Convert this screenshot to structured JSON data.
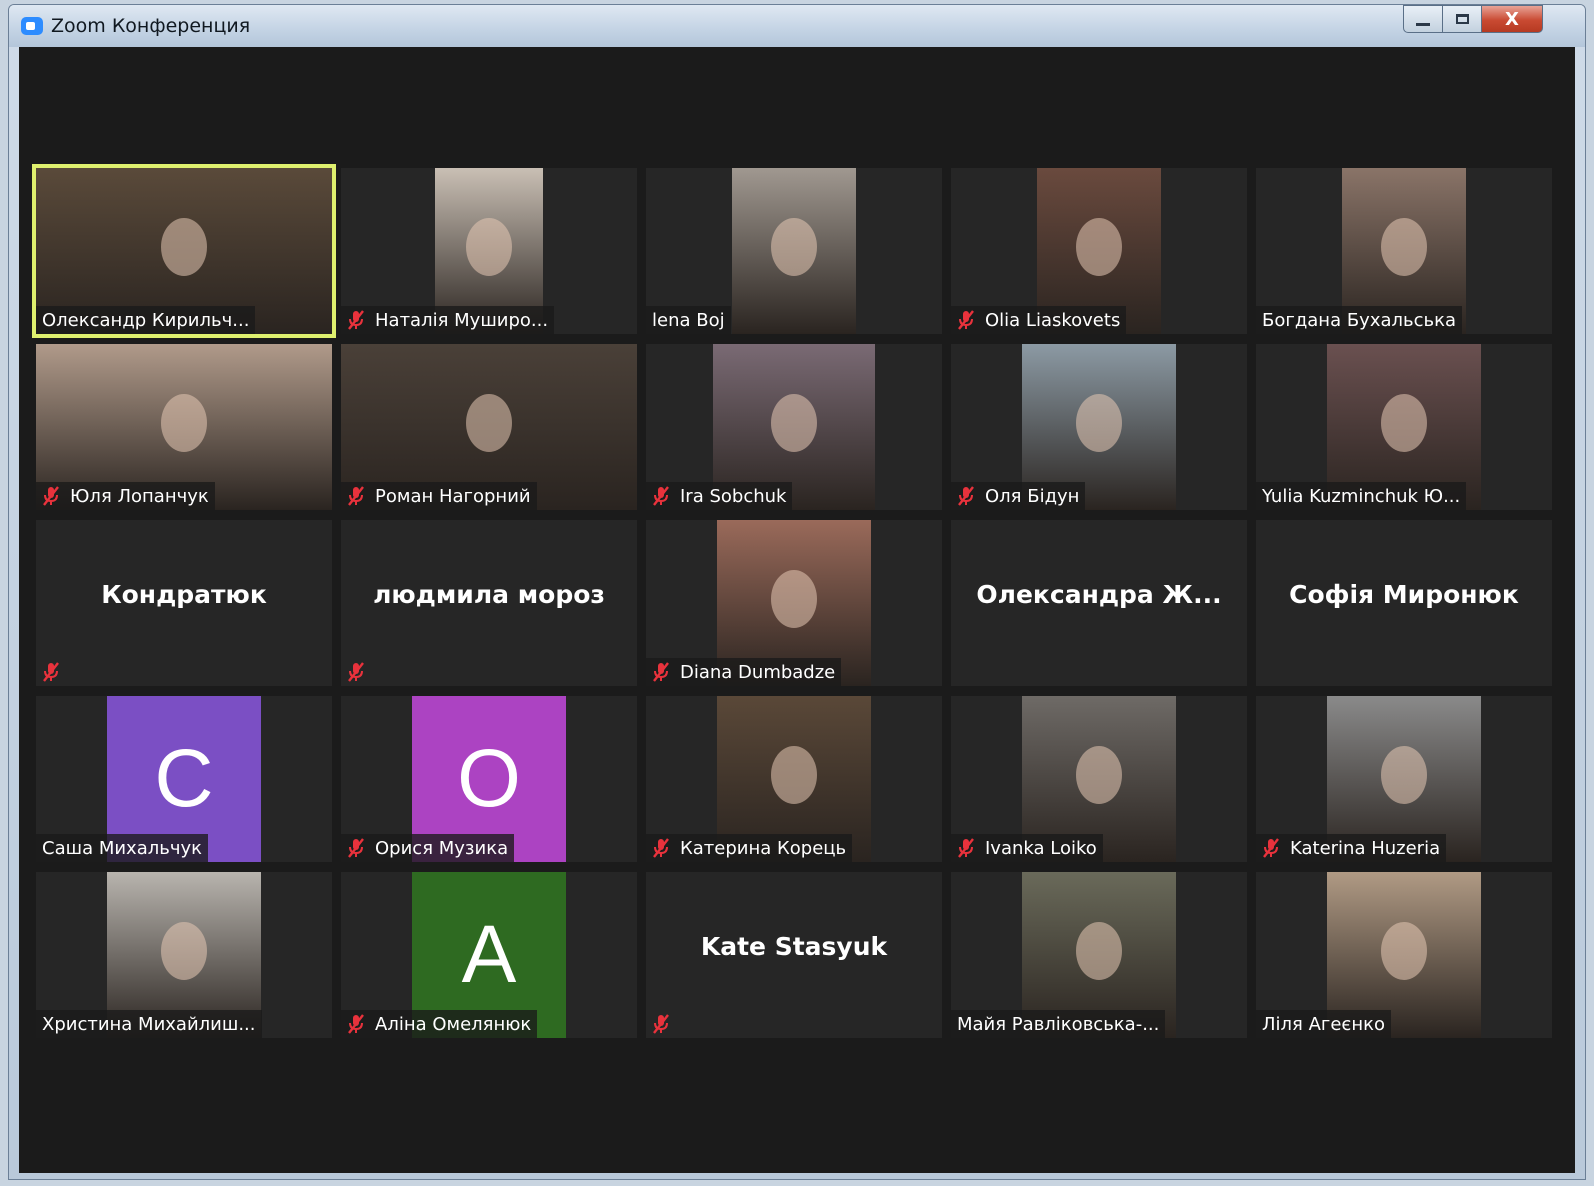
{
  "window": {
    "title": "Zoom Конференция",
    "close_glyph": "X"
  },
  "colors": {
    "muted_mic": "#e8323c",
    "active_speaker": "#dff06e",
    "tile_bg": "#262626",
    "grid_bg": "#1b1b1b"
  },
  "participants": [
    {
      "name": "Олександр Кирильч...",
      "video": "on",
      "muted": false,
      "active": true,
      "pic_color": "#5a4a3a",
      "pic_width": 296
    },
    {
      "name": "Наталія Муширо...",
      "video": "on",
      "muted": true,
      "pic_color": "#c9bfb4",
      "pic_width": 108
    },
    {
      "name": "lena Boj",
      "video": "on",
      "muted": false,
      "pic_color": "#a09890",
      "pic_width": 124
    },
    {
      "name": "Olia Liaskovets",
      "video": "on",
      "muted": true,
      "pic_color": "#6a4a3e",
      "pic_width": 124
    },
    {
      "name": "Богдана Бухальська",
      "video": "on",
      "muted": false,
      "pic_color": "#8a7468",
      "pic_width": 124
    },
    {
      "name": "Юля Лопанчук",
      "video": "on",
      "muted": true,
      "pic_color": "#b09a8a",
      "pic_width": 296
    },
    {
      "name": "Роман Нагорний",
      "video": "on",
      "muted": true,
      "pic_color": "#4a4038",
      "pic_width": 296
    },
    {
      "name": "Ira Sobchuk",
      "video": "on",
      "muted": true,
      "pic_color": "#7a6a74",
      "pic_width": 162
    },
    {
      "name": "Оля Бідун",
      "video": "on",
      "muted": true,
      "pic_color": "#8c9aa4",
      "pic_width": 154
    },
    {
      "name": "Yulia Kuzminchuk Ю...",
      "video": "on",
      "muted": false,
      "pic_color": "#6a5050",
      "pic_width": 154
    },
    {
      "name": "Кондратюк",
      "video": "off",
      "muted": true
    },
    {
      "name": "людмила мороз",
      "video": "off",
      "muted": true
    },
    {
      "name": "Diana Dumbadze",
      "video": "on",
      "muted": true,
      "pic_color": "#9a6a5a",
      "pic_width": 154
    },
    {
      "name": "Олександра Ж...",
      "video": "off",
      "muted": false
    },
    {
      "name": "Софія Миронюк",
      "video": "off",
      "muted": false
    },
    {
      "name": "Саша Михальчук",
      "video": "avatar",
      "muted": false,
      "initial": "C",
      "avatar_color": "#7b4fc4"
    },
    {
      "name": "Орися Музика",
      "video": "avatar",
      "muted": true,
      "initial": "O",
      "avatar_color": "#ac43c2"
    },
    {
      "name": "Катерина Корець",
      "video": "on",
      "muted": true,
      "pic_color": "#5a4838",
      "pic_width": 154
    },
    {
      "name": "Ivanka Loiko",
      "video": "on",
      "muted": true,
      "pic_color": "#6e6a66",
      "pic_width": 154
    },
    {
      "name": "Katerina Huzeria",
      "video": "on",
      "muted": true,
      "pic_color": "#8a8a8a",
      "pic_width": 154
    },
    {
      "name": "Христина Михайлиш...",
      "video": "on",
      "muted": false,
      "pic_color": "#b8b4ae",
      "pic_width": 154
    },
    {
      "name": "Аліна Омелянюк",
      "video": "avatar",
      "muted": true,
      "initial": "A",
      "avatar_color": "#2e6a21"
    },
    {
      "name": "Kate Stasyuk",
      "video": "off",
      "muted": true
    },
    {
      "name": "Майя Равліковська-...",
      "video": "on",
      "muted": false,
      "pic_color": "#6a6a5a",
      "pic_width": 154
    },
    {
      "name": "Ліля Агеєнко",
      "video": "on",
      "muted": false,
      "pic_color": "#b09a84",
      "pic_width": 154
    }
  ]
}
